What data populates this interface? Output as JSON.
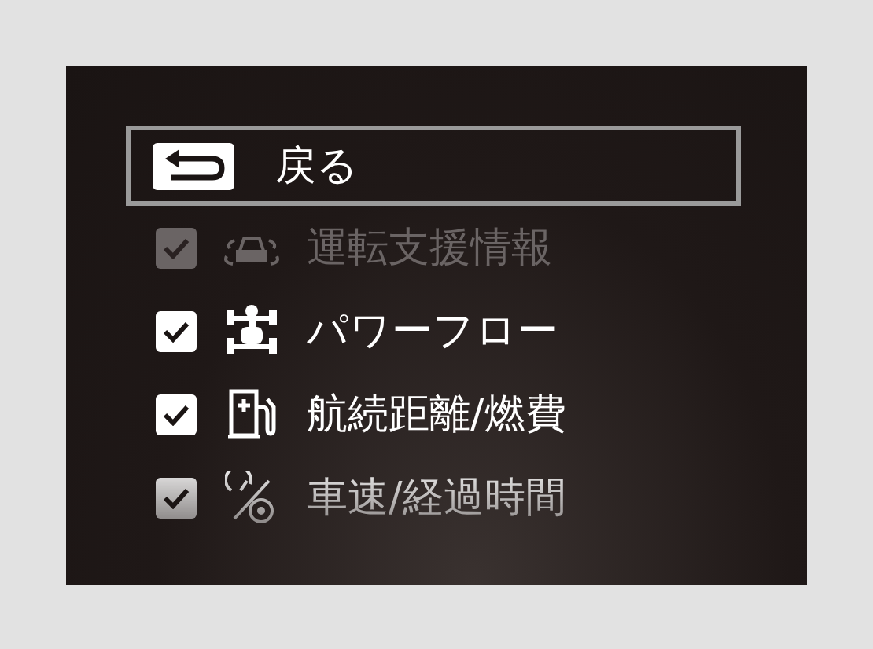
{
  "back": {
    "label": "戻る",
    "selected": true
  },
  "items": [
    {
      "kind": "assist",
      "label": "運転支援情報",
      "checked": true,
      "disabled": true
    },
    {
      "kind": "powerflow",
      "label": "パワーフロー",
      "checked": true,
      "disabled": false
    },
    {
      "kind": "fuel",
      "label": "航続距離/燃費",
      "checked": true,
      "disabled": false
    },
    {
      "kind": "speed",
      "label": "車速/経過時間",
      "checked": true,
      "disabled": false
    }
  ]
}
